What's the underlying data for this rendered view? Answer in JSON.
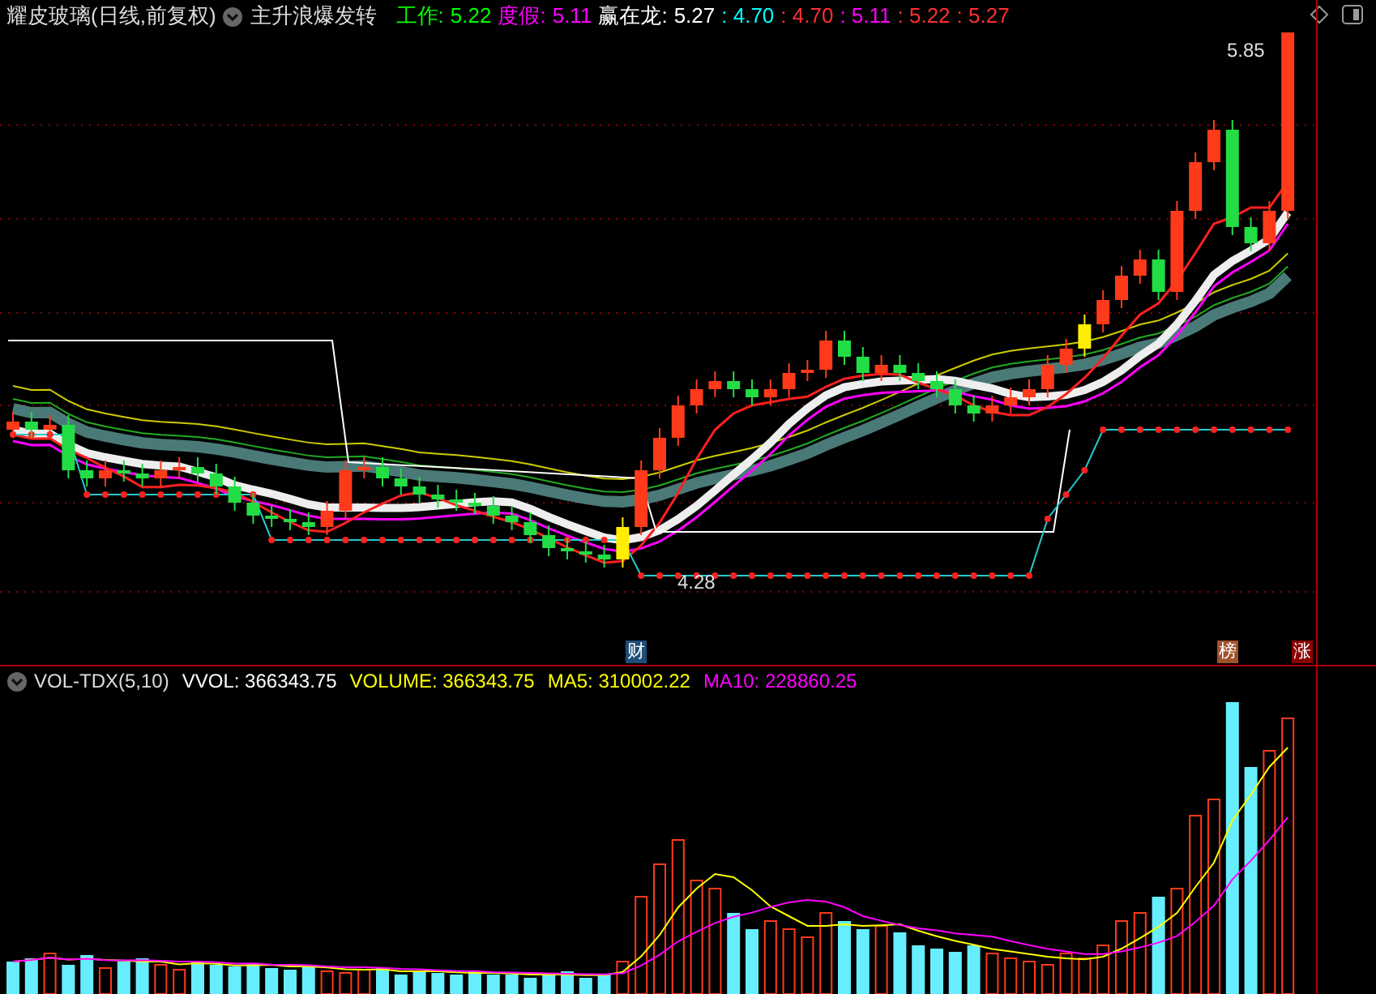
{
  "header": {
    "stock_name": "耀皮玻璃(日线,前复权)",
    "indicator_name": "主升浪爆发转",
    "values": [
      {
        "text": "工作:",
        "color": "#00ff00"
      },
      {
        "text": "5.22",
        "color": "#00ff00"
      },
      {
        "text": "度假:",
        "color": "#ff00ff"
      },
      {
        "text": "5.11",
        "color": "#ff00ff"
      },
      {
        "text": "赢在龙:",
        "color": "#ffffff"
      },
      {
        "text": "5.27",
        "color": "#ffffff"
      },
      {
        "text": ": 4.70",
        "color": "#00ffff"
      },
      {
        "text": ": 4.70",
        "color": "#ff3030"
      },
      {
        "text": ": 5.11",
        "color": "#ff00ff"
      },
      {
        "text": ": 5.22",
        "color": "#ff3030"
      },
      {
        "text": ": 5.27",
        "color": "#ff3030"
      }
    ]
  },
  "price_chart": {
    "high_label": "5.85",
    "low_label": "4.28"
  },
  "markers": [
    {
      "text": "财",
      "color": "#1e4e79"
    },
    {
      "text": "榜",
      "color": "#a0522d"
    },
    {
      "text": "涨",
      "color": "#8b0000"
    }
  ],
  "volume_header": {
    "name": "VOL-TDX(5,10)",
    "values": [
      {
        "text": "VVOL: 366343.75",
        "color": "#ffffff"
      },
      {
        "text": "VOLUME: 366343.75",
        "color": "#ffff00"
      },
      {
        "text": "MA5: 310002.22",
        "color": "#ffff00"
      },
      {
        "text": "MA10: 228860.25",
        "color": "#ff00ff"
      }
    ]
  }
}
